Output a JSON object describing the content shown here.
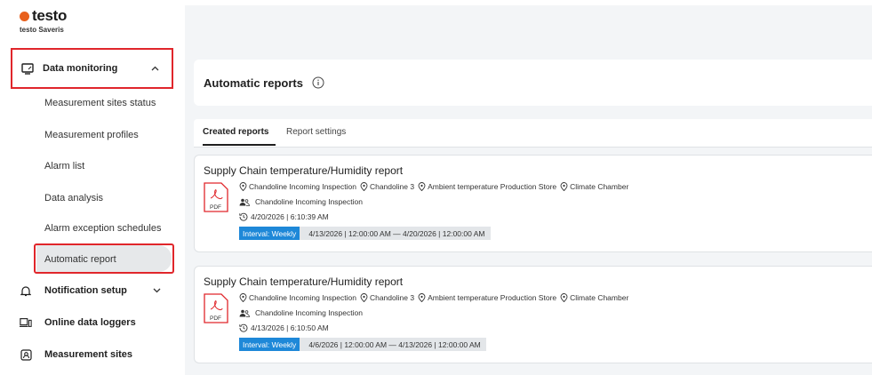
{
  "brand": {
    "name": "testo",
    "product": "testo Saveris",
    "accent": "#e8601c"
  },
  "sidebar": {
    "group_label": "Data monitoring",
    "sub_items": [
      "Measurement sites status",
      "Measurement profiles",
      "Alarm list",
      "Data analysis",
      "Alarm exception schedules",
      "Automatic report"
    ],
    "active_sub": "Automatic report",
    "nav_items": [
      {
        "label": "Notification setup",
        "icon": "bell-icon"
      },
      {
        "label": "Online data loggers",
        "icon": "devices-icon"
      },
      {
        "label": "Measurement sites",
        "icon": "site-icon"
      }
    ]
  },
  "main": {
    "title": "Automatic reports",
    "tabs": {
      "created": "Created reports",
      "settings": "Report settings"
    },
    "reports": [
      {
        "title": "Supply Chain temperature/Humidity report",
        "file_type": "PDF",
        "locations": [
          "Chandoline Incoming Inspection",
          "Chandoline 3",
          "Ambient temperature Production Store",
          "Climate Chamber"
        ],
        "recipient": "Chandoline Incoming Inspection",
        "created": "4/20/2026 | 6:10:39 AM",
        "interval": "Interval: Weekly",
        "range": "4/13/2026 | 12:00:00 AM  —  4/20/2026 | 12:00:00 AM"
      },
      {
        "title": "Supply Chain temperature/Humidity report",
        "file_type": "PDF",
        "locations": [
          "Chandoline Incoming Inspection",
          "Chandoline 3",
          "Ambient temperature Production Store",
          "Climate Chamber"
        ],
        "recipient": "Chandoline Incoming Inspection",
        "created": "4/13/2026 | 6:10:50 AM",
        "interval": "Interval: Weekly",
        "range": "4/6/2026 | 12:00:00 AM  —  4/13/2026 | 12:00:00 AM"
      }
    ]
  },
  "colors": {
    "highlight_border": "#e0262b",
    "interval_blue": "#1e88d8"
  }
}
